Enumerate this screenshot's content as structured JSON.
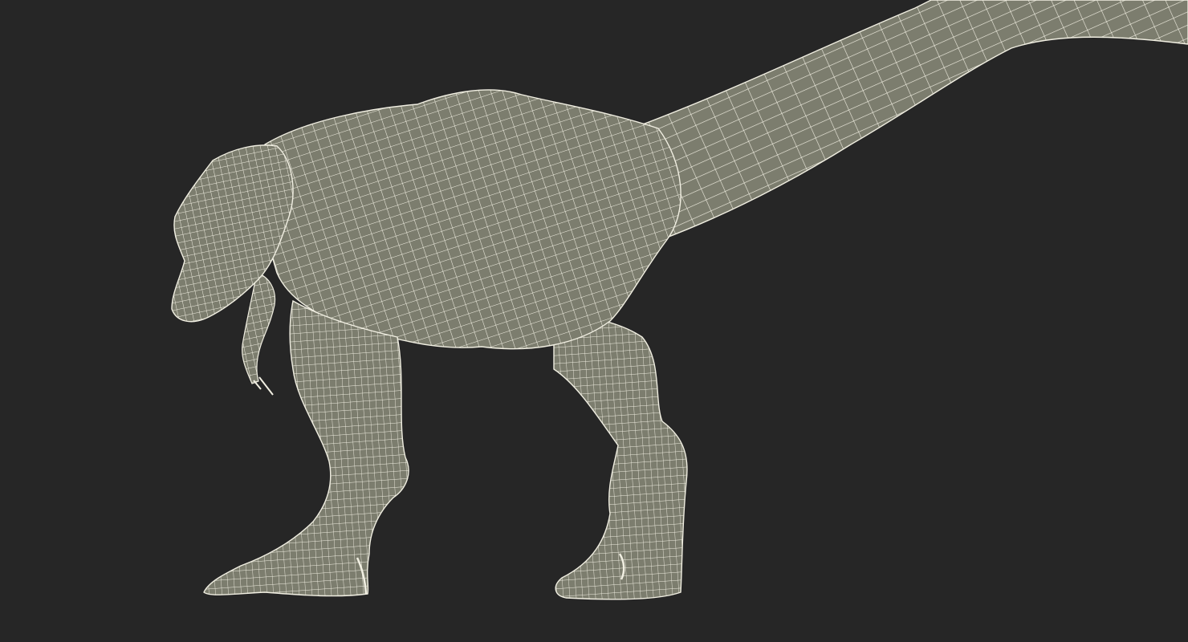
{
  "scene": {
    "subject": "t-rex-wireframe-model",
    "colors": {
      "background": "#262626",
      "mesh_fill": "#7c7d6e",
      "mesh_fill_shadow": "#6f7062",
      "wire": "#f1efe2"
    }
  }
}
